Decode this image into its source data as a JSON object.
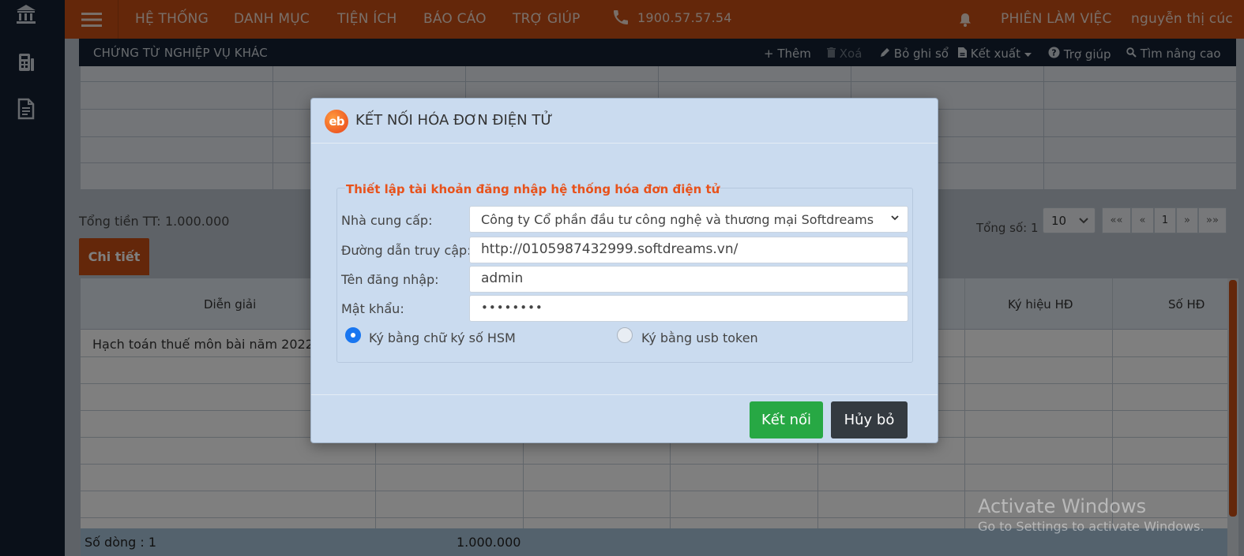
{
  "nav": {
    "items": [
      "HỆ THỐNG",
      "DANH MỤC",
      "TIỆN ÍCH",
      "BÁO CÁO",
      "TRỢ GIÚP"
    ],
    "phone": "1900.57.57.54",
    "session": "PHIÊN LÀM VIỆC",
    "user": "nguyễn thị cúc"
  },
  "sidebar": {
    "icons": [
      "bank-icon",
      "calculator-icon",
      "invoice-icon"
    ]
  },
  "toolbar": {
    "title": "CHỨNG TỪ NGHIỆP VỤ KHÁC",
    "add": "+ Thêm",
    "delete": "Xoá",
    "unpost": "Bỏ ghi sổ",
    "export": "Kết xuất",
    "help": "Trợ giúp",
    "search": "Tìm nâng cao"
  },
  "summary": {
    "total_label": "Tổng tiền TT:",
    "total_value": "1.000.000",
    "count_label": "Tổng số: 1",
    "page_size": "10",
    "pager": [
      "««",
      "«",
      "1",
      "»",
      "»»"
    ]
  },
  "tab": {
    "label": "Chi tiết"
  },
  "detail": {
    "columns": [
      "Diễn giải",
      "Ký hiệu HĐ",
      "Số HĐ"
    ],
    "rows": [
      {
        "description": "Hạch toán thuế môn bài năm 2022"
      }
    ],
    "footer": {
      "rows_label": "Số dòng : 1",
      "amount": "1.000.000"
    }
  },
  "watermark": {
    "line1": "Activate Windows",
    "line2": "Go to Settings to activate Windows."
  },
  "modal": {
    "logo_text": "eb",
    "title": "KẾT NỐI HÓA ĐƠN ĐIỆN TỬ",
    "section": "Thiết lập tài khoản đăng nhập hệ thống hóa đơn điện tử",
    "provider_label": "Nhà cung cấp:",
    "provider_value": "Công ty Cổ phần đầu tư công nghệ và thương mại Softdreams",
    "url_label": "Đường dẫn truy cập:",
    "url_value": "http://0105987432999.softdreams.vn/",
    "username_label": "Tên đăng nhập:",
    "username_value": "admin",
    "password_label": "Mật khẩu:",
    "password_value": "••••••••",
    "option_hsm": "Ký bằng chữ ký số HSM",
    "option_usb": "Ký bằng usb token",
    "selected_option": "hsm",
    "connect": "Kết nối",
    "cancel": "Hủy bỏ"
  },
  "colors": {
    "brand_orange": "#c94f14",
    "dark_nav": "#142132",
    "modal_bg": "#cadbef",
    "success": "#27a844",
    "legend_orange": "#e8521b"
  }
}
